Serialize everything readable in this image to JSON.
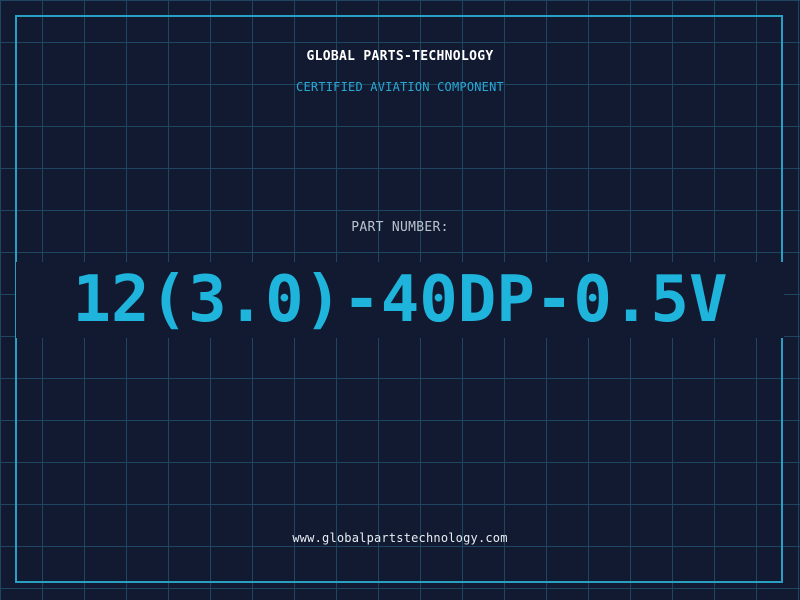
{
  "header": {
    "company": "GLOBAL PARTS-TECHNOLOGY",
    "subtitle": "CERTIFIED AVIATION COMPONENT"
  },
  "part": {
    "label": "PART NUMBER:",
    "number": "12(3.0)-40DP-0.5V"
  },
  "footer": {
    "website": "www.globalpartstechnology.com"
  },
  "colors": {
    "background": "#111a30",
    "grid": "#1f4660",
    "frame": "#2a9fc4",
    "accent": "#1fb4dc"
  }
}
